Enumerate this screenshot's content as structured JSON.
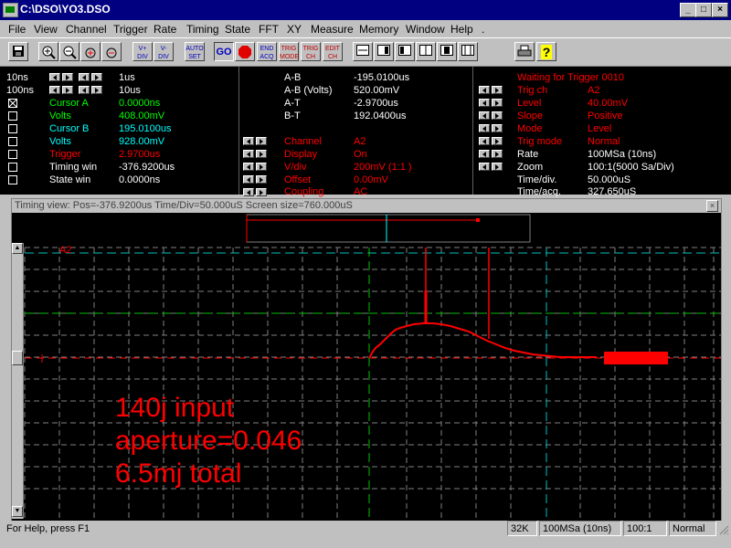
{
  "window": {
    "title": "C:\\DSO\\YO3.DSO"
  },
  "menu": [
    "File",
    "View",
    "Channel",
    "Trigger",
    "Rate",
    "Timing",
    "State",
    "FFT",
    "XY",
    "Measure",
    "Memory",
    "Window",
    "Help",
    "."
  ],
  "toolbar": {
    "buttons": [
      "save",
      "zoom-in",
      "zoom-out",
      "zoom-in-2",
      "zoom-out-2",
      "V+ DIV",
      "V- DIV",
      "AUTO SET",
      "GO",
      "STOP",
      "END ACQ",
      "TRIG MODE",
      "TRIG CH",
      "EDIT CH",
      "view-1",
      "view-2",
      "view-3",
      "view-4",
      "view-5",
      "view-6",
      "print",
      "help"
    ]
  },
  "cursors": {
    "rows": [
      {
        "label": "10ns",
        "value": "1us"
      },
      {
        "label": "100ns",
        "value": "10us"
      }
    ],
    "items": [
      {
        "name": "Cursor A",
        "value": "0.0000ns",
        "color": "#00ff00"
      },
      {
        "name": "Volts",
        "value": "408.00mV",
        "color": "#00ff00"
      },
      {
        "name": "Cursor B",
        "value": "195.0100us",
        "color": "#00ffff"
      },
      {
        "name": "Volts",
        "value": "928.00mV",
        "color": "#00ffff"
      },
      {
        "name": "Trigger",
        "value": "2.9700us",
        "color": "#ff0000"
      },
      {
        "name": "Timing win",
        "value": "-376.9200us",
        "color": "#ffffff"
      },
      {
        "name": "State win",
        "value": "0.0000ns",
        "color": "#ffffff"
      }
    ]
  },
  "measure": [
    {
      "label": "A-B",
      "value": "-195.0100us"
    },
    {
      "label": "A-B (Volts)",
      "value": "520.00mV"
    },
    {
      "label": "A-T",
      "value": "-2.9700us"
    },
    {
      "label": "B-T",
      "value": "192.0400us"
    }
  ],
  "channel": [
    {
      "label": "Channel",
      "value": "A2"
    },
    {
      "label": "Display",
      "value": "On"
    },
    {
      "label": "V/div",
      "value": "200mV (1:1   )"
    },
    {
      "label": "Offset",
      "value": "0.00mV"
    },
    {
      "label": "Coupling",
      "value": "AC"
    }
  ],
  "trigger": {
    "status": "Waiting for Trigger 0010",
    "items": [
      {
        "label": "Trig ch",
        "value": "A2",
        "color": "#ff0000"
      },
      {
        "label": "Level",
        "value": "40.00mV",
        "color": "#ff0000"
      },
      {
        "label": "Slope",
        "value": "Positive",
        "color": "#ff0000"
      },
      {
        "label": "Mode",
        "value": "Level",
        "color": "#ff0000"
      },
      {
        "label": "Trig mode",
        "value": "Normal",
        "color": "#ff0000"
      },
      {
        "label": "Rate",
        "value": "100MSa (10ns)",
        "color": "#ffffff"
      },
      {
        "label": "Zoom",
        "value": "100:1(5000 Sa/Div)",
        "color": "#ffffff"
      },
      {
        "label": "Time/div.",
        "value": "50.000uS",
        "color": "#ffffff"
      },
      {
        "label": "Time/acq.",
        "value": "327.650uS",
        "color": "#ffffff"
      }
    ]
  },
  "timing_view": {
    "title": "Timing view: Pos=-376.9200us Time/Div=50.000uS Screen size=760.000uS",
    "channel_label": "A2",
    "annotation": [
      "140j  input",
      "aperture=0.046",
      "6.5mj total"
    ],
    "trace_color": "#ff0000"
  },
  "status": {
    "help": "For Help, press F1",
    "memory": "32K",
    "rate": "100MSa (10ns)",
    "zoom": "100:1",
    "mode": "Normal"
  }
}
